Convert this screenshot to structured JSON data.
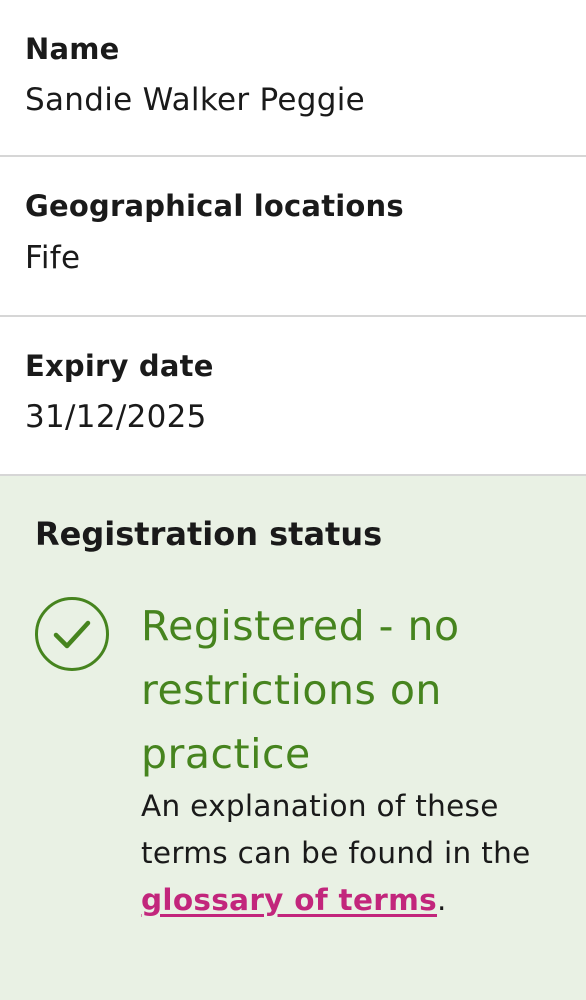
{
  "fields": {
    "name": {
      "label": "Name",
      "value": "Sandie Walker Peggie"
    },
    "geographical_locations": {
      "label": "Geographical locations",
      "value": "Fife"
    },
    "expiry_date": {
      "label": "Expiry date",
      "value": "31/12/2025"
    }
  },
  "registration": {
    "heading": "Registration status",
    "status": "Registered - no restrictions on practice",
    "status_color": "#46841e",
    "icon": "check-circle-icon",
    "explanation_prefix": "An explanation of these terms can be found in the",
    "glossary_link": "glossary of terms",
    "explanation_suffix": ".",
    "link_color": "#c2267c",
    "panel_background": "#e9f1e4"
  }
}
